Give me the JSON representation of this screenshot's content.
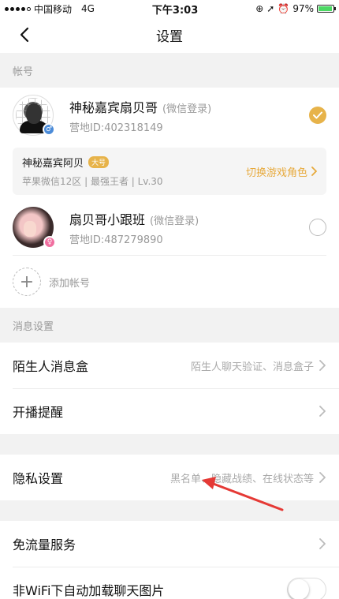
{
  "status_bar": {
    "carrier": "中国移动",
    "network": "4G",
    "time": "下午3:03",
    "battery_pct": "97%",
    "battery_level": 0.97
  },
  "nav": {
    "title": "设置",
    "back_icon": "chevron-left-icon"
  },
  "account_section": {
    "header": "帐号",
    "accounts": [
      {
        "name": "神秘嘉宾扇贝哥",
        "login_type": "(微信登录)",
        "id_text": "营地ID:402318149",
        "gender_symbol": "♂",
        "selected": true
      },
      {
        "name": "扇贝哥小跟班",
        "login_type": "(微信登录)",
        "id_text": "营地ID:487279890",
        "gender_symbol": "♀",
        "selected": false
      }
    ],
    "game_role": {
      "name": "神秘嘉宾阿贝",
      "tag": "大号",
      "sub": "苹果微信12区 | 最强王者 | Lv.30",
      "switch_label": "切换游戏角色"
    },
    "add_label": "添加帐号"
  },
  "message_section": {
    "header": "消息设置",
    "items": [
      {
        "label": "陌生人消息盒",
        "value": "陌生人聊天验证、消息盒子"
      },
      {
        "label": "开播提醒",
        "value": ""
      }
    ]
  },
  "privacy_section": {
    "items": [
      {
        "label": "隐私设置",
        "value": "黑名单、隐藏战绩、在线状态等"
      }
    ]
  },
  "data_section": {
    "items": [
      {
        "label": "免流量服务",
        "value": ""
      },
      {
        "label": "非WiFi下自动加载聊天图片",
        "toggle_on": false
      }
    ]
  },
  "colors": {
    "accent": "#e7b34a",
    "arrow": "#e53935"
  }
}
